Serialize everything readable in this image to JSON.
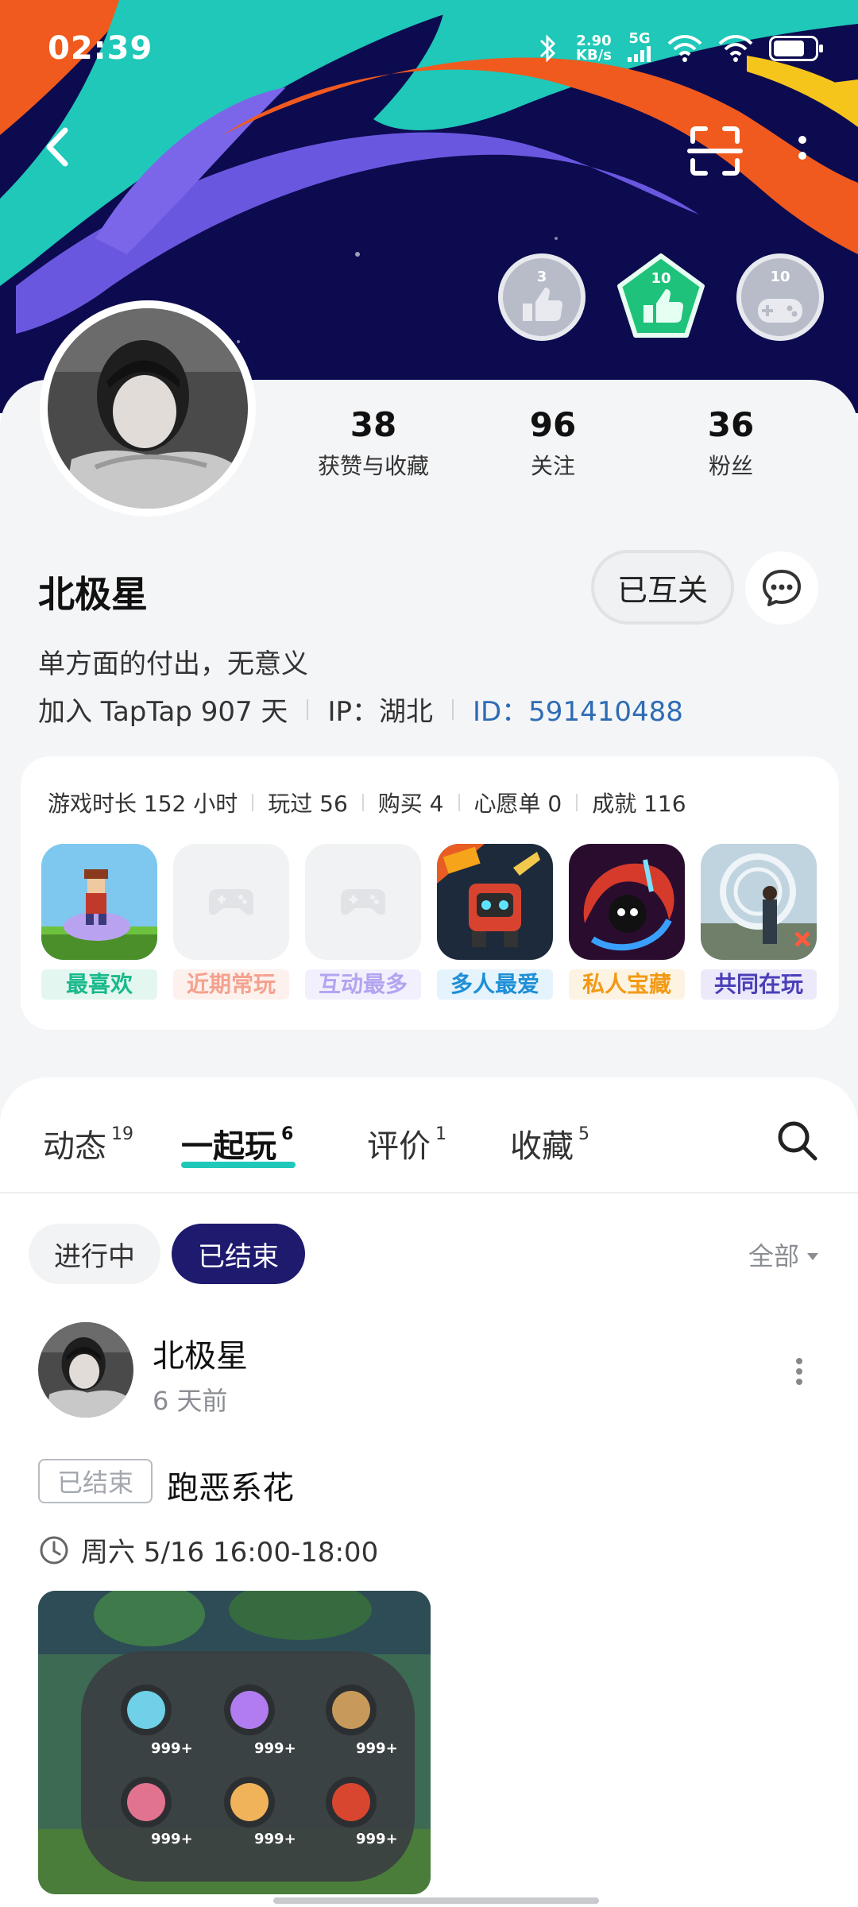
{
  "status_bar": {
    "time": "02:39",
    "net_speed_value": "2.90",
    "net_speed_unit": "KB/s",
    "network": "5G"
  },
  "colors": {
    "banner_bg": "#0d0b4f",
    "accent_teal": "#1fc8b8",
    "ended_pill": "#1e1a6e",
    "uid_blue": "#2e6cb5"
  },
  "badges": [
    {
      "level": "3",
      "icon": "thumbs-up-badge-icon"
    },
    {
      "level": "10",
      "icon": "thumbs-up-badge-icon"
    },
    {
      "level": "10",
      "icon": "gamepad-badge-icon"
    }
  ],
  "stats": [
    {
      "value": "38",
      "label": "获赞与收藏"
    },
    {
      "value": "96",
      "label": "关注"
    },
    {
      "value": "36",
      "label": "粉丝"
    }
  ],
  "profile": {
    "name": "北极星",
    "mutual_label": "已互关",
    "bio": "单方面的付出，无意义",
    "joined": "加入 TapTap 907 天",
    "ip": "IP：湖北",
    "uid": "ID：591410488"
  },
  "game_stats": [
    "游戏时长 152 小时",
    "玩过 56",
    "购买 4",
    "心愿单 0",
    "成就 116"
  ],
  "game_slots": [
    {
      "label": "最喜欢",
      "color": "#19b98a",
      "bg": "#e3f7f0",
      "icon": "terraria-game-icon"
    },
    {
      "label": "近期常玩",
      "color": "#f4a28e",
      "bg": "#fdf1ee",
      "icon": "gamepad-placeholder-icon"
    },
    {
      "label": "互动最多",
      "color": "#b3a4f0",
      "bg": "#f3f0fd",
      "icon": "gamepad-placeholder-icon"
    },
    {
      "label": "多人最爱",
      "color": "#1d8fd6",
      "bg": "#e5f3fc",
      "icon": "soul-knight-game-icon"
    },
    {
      "label": "私人宝藏",
      "color": "#f29a16",
      "bg": "#fdf3e2",
      "icon": "rogue-game-icon"
    },
    {
      "label": "共同在玩",
      "color": "#4a3fb8",
      "bg": "#ebe9fa",
      "icon": "open-world-game-icon"
    }
  ],
  "tabs": [
    {
      "label": "动态",
      "count": "19"
    },
    {
      "label": "一起玩",
      "count": "6"
    },
    {
      "label": "评价",
      "count": "1"
    },
    {
      "label": "收藏",
      "count": "5"
    }
  ],
  "filter": {
    "ongoing": "进行中",
    "ended": "已结束",
    "scope": "全部"
  },
  "post": {
    "author": "北极星",
    "time": "6 天前",
    "status_tag": "已结束",
    "title": "跑恶系花",
    "schedule": "周六 5/16 16:00-18:00",
    "item_count": "999+"
  }
}
